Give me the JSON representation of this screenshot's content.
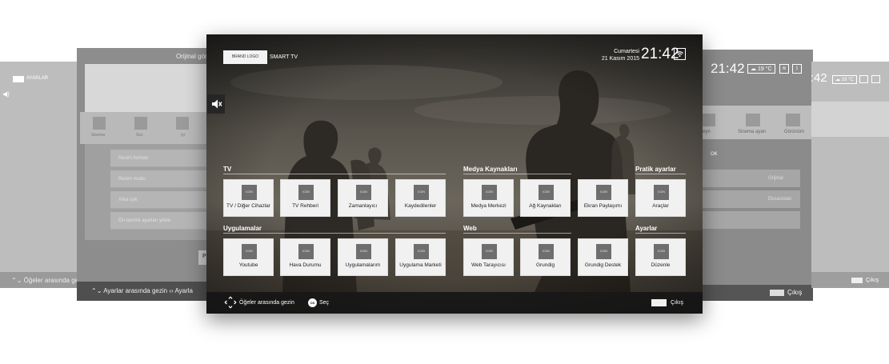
{
  "background_left_far": {
    "brand_label": "AYARLAR",
    "footer_text": "Öğeler arasında gezin"
  },
  "background_left_near": {
    "title": "Orijinal görün",
    "tabs": [
      "Sinema",
      "Sıcı",
      "Iyi"
    ],
    "list_items": [
      "Resim formatı",
      "Resim modu",
      "Arka ışık",
      "Ön tanımlı ayarları yükle"
    ],
    "p_button": "P",
    "footer_text": "Ayarlar arasında gezin",
    "footer_adjust": "Ayarla"
  },
  "background_right_near": {
    "time": "21:42",
    "weather": "19 °C",
    "tabs": [
      "...veyn",
      "Sinema ayarı",
      "Görünüm"
    ],
    "ok_label": "OK",
    "rows": [
      "",
      "Orijinal",
      "Ekoasistan"
    ],
    "exit_label": "Çıkış"
  },
  "background_right_far": {
    "time": "21:42",
    "weather": "19 °C",
    "exit_label": "Çıkış"
  },
  "main": {
    "brand_logo": "BRAND LOGO",
    "brand_name": "SMART TV",
    "day": "Cumartesi",
    "date": "21 Kasım 2015",
    "time": "21:42",
    "tile_icon_text": "ICON",
    "sections": {
      "tv": {
        "title": "TV",
        "tiles": [
          "TV / Diğer Cihazlar",
          "TV Rehberi",
          "Zamanlayıcı",
          "Kaydedilenler"
        ]
      },
      "media": {
        "title": "Medya Kaynakları",
        "tiles": [
          "Medya Merkezi",
          "Ağ Kaynakları",
          "Ekran Paylaşımı"
        ]
      },
      "quick": {
        "title": "Pratik ayarlar",
        "tiles": [
          "Araçlar"
        ]
      },
      "apps": {
        "title": "Uygulamalar",
        "tiles": [
          "Youtube",
          "Hava Durumu",
          "Uygulamalarım",
          "Uygulama Marketi"
        ]
      },
      "web": {
        "title": "Web",
        "tiles": [
          "Web Tarayıcısı",
          "Grundig",
          "Grundig Destek"
        ]
      },
      "settings": {
        "title": "Ayarlar",
        "tiles": [
          "Düzenle"
        ]
      }
    },
    "footer": {
      "nav_text": "Öğeler arasında gezin",
      "ok_badge": "OK",
      "ok_text": "Seç",
      "exit_text": "Çıkış"
    }
  }
}
